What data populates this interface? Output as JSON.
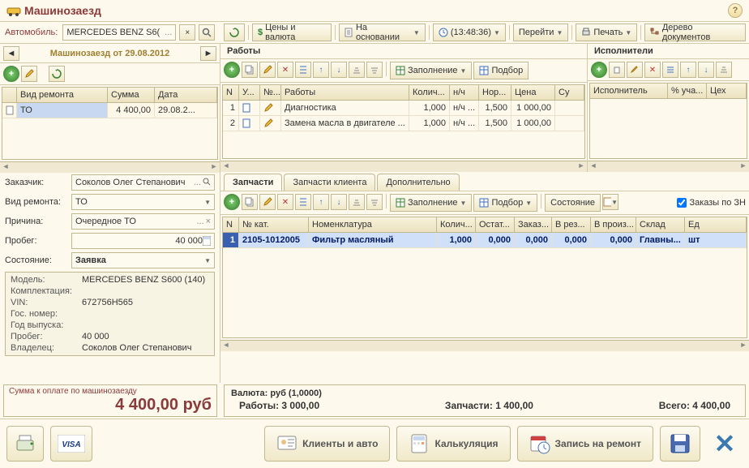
{
  "title": "Машинозаезд",
  "car_label": "Автомобиль:",
  "car_value": "MERCEDES BENZ S6(",
  "nav_title": "Машинозаезд от 29.08.2012",
  "top_toolbar": {
    "prices": "Цены и валюта",
    "basis": "На основании",
    "time": "(13:48:36)",
    "goto": "Перейти",
    "print": "Печать",
    "tree": "Дерево документов"
  },
  "repair_grid": {
    "headers": {
      "type": "Вид ремонта",
      "sum": "Сумма",
      "date": "Дата"
    },
    "row": {
      "type": "ТО",
      "sum": "4 400,00",
      "date": "29.08.2..."
    }
  },
  "form": {
    "customer_label": "Заказчик:",
    "customer": "Соколов Олег Степанович",
    "repair_type_label": "Вид ремонта:",
    "repair_type": "ТО",
    "reason_label": "Причина:",
    "reason": "Очередное ТО",
    "mileage_label": "Пробег:",
    "mileage": "40 000",
    "state_label": "Состояние:",
    "state": "Заявка"
  },
  "info": {
    "model_k": "Модель:",
    "model_v": "MERCEDES BENZ S600 (140)",
    "config_k": "Комплектация:",
    "config_v": "",
    "vin_k": "VIN:",
    "vin_v": "672756Н565",
    "gos_k": "Гос. номер:",
    "gos_v": "",
    "year_k": "Год выпуска:",
    "year_v": "",
    "mileage_k": "Пробег:",
    "mileage_v": "40 000",
    "owner_k": "Владелец:",
    "owner_v": "Соколов Олег Степанович"
  },
  "works": {
    "title": "Работы",
    "executors_title": "Исполнители",
    "fill": "Заполнение",
    "select": "Подбор",
    "headers": {
      "n": "N",
      "u": "У...",
      "no": "№...",
      "works": "Работы",
      "qty": "Колич...",
      "nh": "н/ч",
      "norm": "Нор...",
      "price": "Цена",
      "s": "Су"
    },
    "exec_headers": {
      "executor": "Исполнитель",
      "pct": "% уча...",
      "shop": "Цех"
    },
    "rows": [
      {
        "n": "1",
        "name": "Диагностика",
        "qty": "1,000",
        "nh": "н/ч ...",
        "norm": "1,500",
        "price": "1 000,00"
      },
      {
        "n": "2",
        "name": "Замена масла в двигателе ...",
        "qty": "1,000",
        "nh": "н/ч ...",
        "norm": "1,500",
        "price": "1 000,00"
      }
    ]
  },
  "parts": {
    "tabs": {
      "parts": "Запчасти",
      "client_parts": "Запчасти клиента",
      "extra": "Дополнительно"
    },
    "fill": "Заполнение",
    "select": "Подбор",
    "state": "Состояние",
    "orders": "Заказы по ЗН",
    "headers": {
      "n": "N",
      "cat": "№ кат.",
      "nom": "Номенклатура",
      "qty": "Колич...",
      "rest": "Остат...",
      "order": "Заказ...",
      "res": "В рез...",
      "prod": "В произ...",
      "store": "Склад",
      "unit": "Ед"
    },
    "row": {
      "n": "1",
      "cat": "2105-1012005",
      "nom": "Фильтр масляный",
      "qty": "1,000",
      "rest": "0,000",
      "order": "0,000",
      "res": "0,000",
      "prod": "0,000",
      "store": "Главны...",
      "unit": "шт"
    }
  },
  "totals": {
    "pay_title": "Сумма к оплате по машинозаезду",
    "amount": "4 400,00  руб",
    "currency_line": "Валюта: руб (1,0000)",
    "works": "Работы: 3 000,00",
    "parts": "Запчасти: 1 400,00",
    "total": "Всего: 4 400,00"
  },
  "footer": {
    "clients": "Клиенты и авто",
    "calc": "Калькуляция",
    "book": "Запись на ремонт"
  }
}
